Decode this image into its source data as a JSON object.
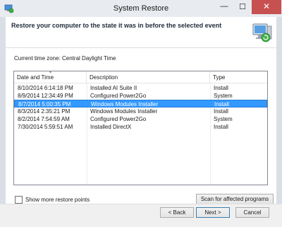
{
  "window": {
    "title": "System Restore"
  },
  "titlebar": {
    "minimize_glyph": "—",
    "maximize_glyph": "☐",
    "close_glyph": "✕"
  },
  "header": {
    "text": "Restore your computer to the state it was in before the selected event"
  },
  "timezone": "Current time zone: Central Daylight Time",
  "list": {
    "columns": [
      "Date and Time",
      "Description",
      "Type"
    ],
    "rows": [
      {
        "date": "8/10/2014 6:14:18 PM",
        "description": "Installed AI Suite II",
        "type": "Install"
      },
      {
        "date": "8/9/2014 12:34:49 PM",
        "description": "Configured Power2Go",
        "type": "System"
      },
      {
        "date": "8/7/2014 5:00:35 PM",
        "description": "Windows Modules Installer",
        "type": "Install"
      },
      {
        "date": "8/3/2014 2:35:21 PM",
        "description": "Windows Modules Installer",
        "type": "Install"
      },
      {
        "date": "8/2/2014 7:54:59 AM",
        "description": "Configured Power2Go",
        "type": "System"
      },
      {
        "date": "7/30/2014 5:59:51 AM",
        "description": "Installed DirectX",
        "type": "Install"
      }
    ],
    "selected_index": 2
  },
  "show_more": {
    "label": "Show more restore points",
    "checked": false
  },
  "buttons": {
    "scan": "Scan for affected programs",
    "back": "< Back",
    "next": "Next >",
    "cancel": "Cancel"
  },
  "colors": {
    "selection": "#3399ff",
    "close_button": "#c75050"
  },
  "icons": {
    "title": "system-restore-icon",
    "header": "restore-computer-icon",
    "sort": "sort-chevron-icon"
  }
}
